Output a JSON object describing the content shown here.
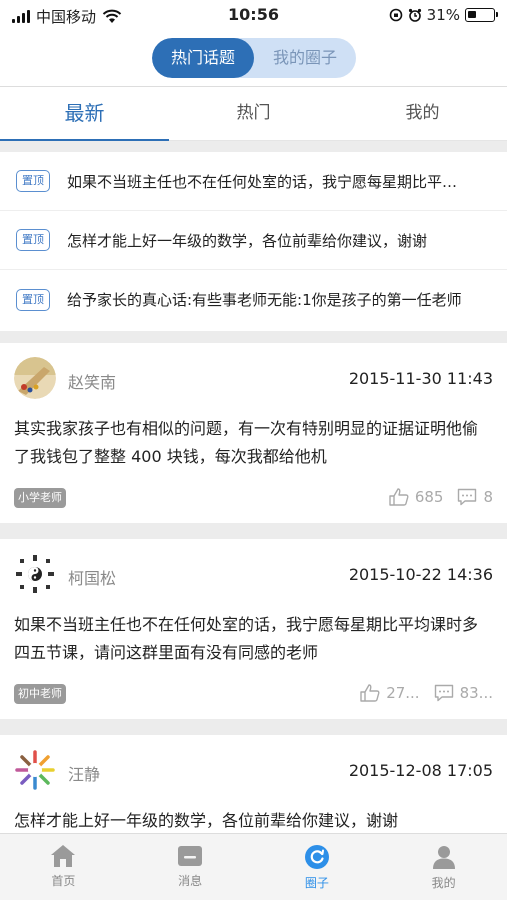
{
  "status": {
    "carrier": "中国移动",
    "time": "10:56",
    "battery": "31%"
  },
  "segment": {
    "items": [
      "热门话题",
      "我的圈子"
    ],
    "active": 0
  },
  "tabs": [
    "最新",
    "热门",
    "我的"
  ],
  "pinned": {
    "tag": "置顶",
    "items": [
      "如果不当班主任也不在任何处室的话，我宁愿每星期比平均课时多四五节课，请问这群里面有没有同感的老师",
      "怎样才能上好一年级的数学，各位前辈给你建议，谢谢",
      "给予家长的真心话:有些事老师无能:1你是孩子的第一任老师"
    ]
  },
  "posts": [
    {
      "name": "赵笑南",
      "date": "2015-11-30 11:43",
      "body": "其实我家孩子也有相似的问题，有一次有特别明显的证据证明他偷了我钱包了整整 400 块钱，每次我都给他机",
      "role": "小学老师",
      "likes": "685",
      "comments": "8"
    },
    {
      "name": "柯国松",
      "date": "2015-10-22 14:36",
      "body": "如果不当班主任也不在任何处室的话，我宁愿每星期比平均课时多四五节课，请问这群里面有没有同感的老师",
      "role": "初中老师",
      "likes": "27...",
      "comments": "83..."
    },
    {
      "name": "汪静",
      "date": "2015-12-08 17:05",
      "body": "怎样才能上好一年级的数学，各位前辈给你建议，谢谢",
      "role": "",
      "likes": "",
      "comments": ""
    }
  ],
  "tabbar": {
    "items": [
      {
        "label": "首页",
        "icon": "home-icon"
      },
      {
        "label": "消息",
        "icon": "message-icon"
      },
      {
        "label": "圈子",
        "icon": "circle-icon"
      },
      {
        "label": "我的",
        "icon": "profile-icon"
      }
    ],
    "active": 2
  },
  "colors": {
    "accent": "#2d6fb6",
    "tab_active": "#2d8fe8"
  }
}
